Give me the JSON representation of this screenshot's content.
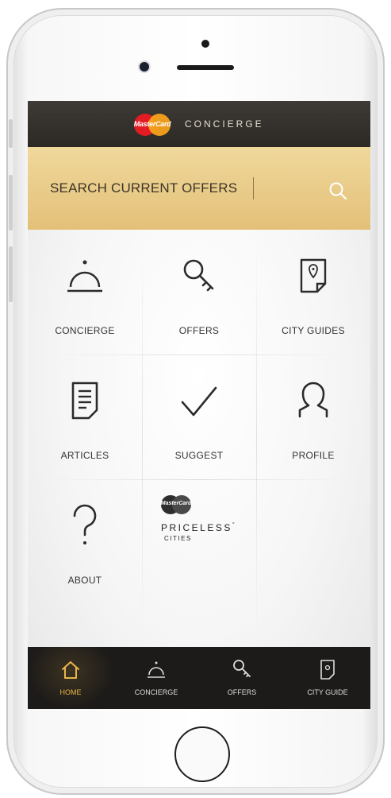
{
  "app": {
    "brand_logo_text": "MasterCard",
    "brand_title": "CONCIERGE"
  },
  "search": {
    "placeholder": "SEARCH CURRENT OFFERS",
    "icon": "search-icon"
  },
  "grid": {
    "items": [
      {
        "label": "CONCIERGE",
        "icon": "service-bell-icon"
      },
      {
        "label": "OFFERS",
        "icon": "key-icon"
      },
      {
        "label": "CITY GUIDES",
        "icon": "map-pin-page-icon"
      },
      {
        "label": "ARTICLES",
        "icon": "document-icon"
      },
      {
        "label": "SUGGEST",
        "icon": "checkmark-icon"
      },
      {
        "label": "PROFILE",
        "icon": "person-icon"
      },
      {
        "label": "ABOUT",
        "icon": "question-mark-icon"
      }
    ],
    "priceless": {
      "logo_text": "MasterCard",
      "title": "PRICELESS",
      "trademark": "°",
      "subtitle": "CITIES"
    }
  },
  "tabbar": {
    "active": "HOME",
    "tabs": [
      {
        "label": "HOME",
        "icon": "home-icon"
      },
      {
        "label": "CONCIERGE",
        "icon": "service-bell-icon"
      },
      {
        "label": "OFFERS",
        "icon": "key-icon"
      },
      {
        "label": "CITY GUIDE",
        "icon": "map-pin-page-icon"
      }
    ]
  },
  "colors": {
    "header_dark": "#2c2925",
    "search_gold": "#e9c985",
    "tab_active": "#e8b648",
    "tabbar_bg": "#1d1b19"
  }
}
